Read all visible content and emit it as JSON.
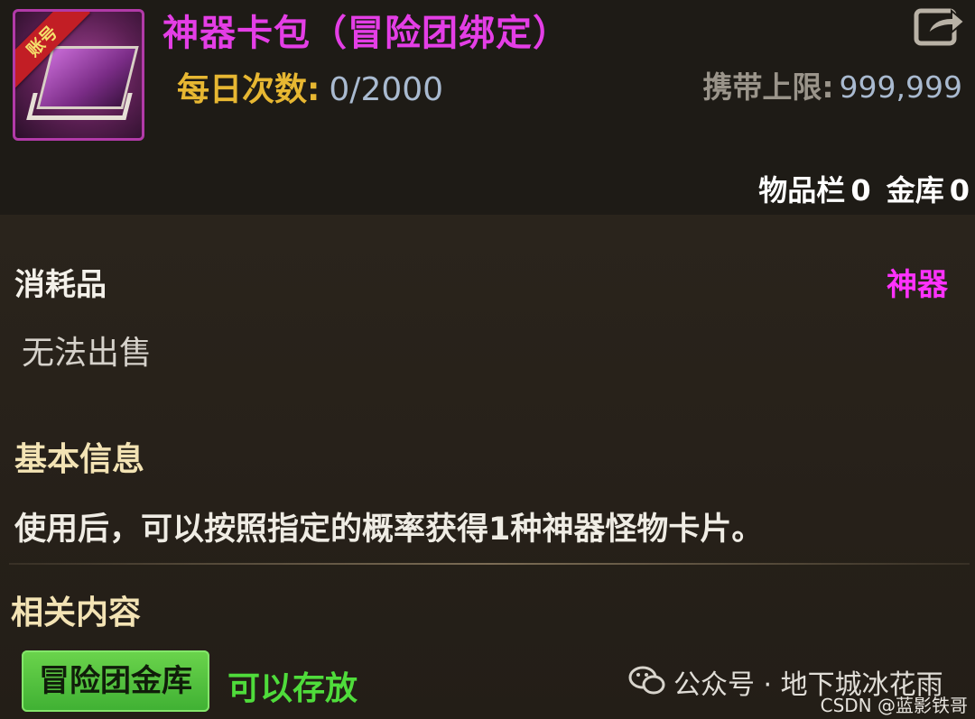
{
  "item": {
    "title": "神器卡包（冒险团绑定）",
    "badge": "账号",
    "daily_label": "每日次数:",
    "daily_value": "0/2000",
    "carry_label": "携带上限:",
    "carry_value": "999,999",
    "storage_inventory_label": "物品栏",
    "storage_inventory_count": "0",
    "storage_bank_label": "金库",
    "storage_bank_count": "0",
    "type": "消耗品",
    "rarity": "神器",
    "sell_status": "无法出售",
    "basic_info_heading": "基本信息",
    "description": "使用后，可以按照指定的概率获得1种神器怪物卡片。",
    "related_heading": "相关内容",
    "related_tag": "冒险团金库",
    "related_status": "可以存放"
  },
  "watermark": {
    "main": "公众号 · 地下城冰花雨",
    "csdn": "CSDN @蓝影铁哥"
  },
  "colors": {
    "title": "#e43ee6",
    "rarity": "#ff32ff",
    "daily_label": "#e7b732",
    "value": "#a9bad0",
    "storable": "#4fdc3b",
    "tag_bg": "#4fc23e"
  },
  "icons": {
    "share": "share-export-icon",
    "wechat": "wechat-icon"
  }
}
